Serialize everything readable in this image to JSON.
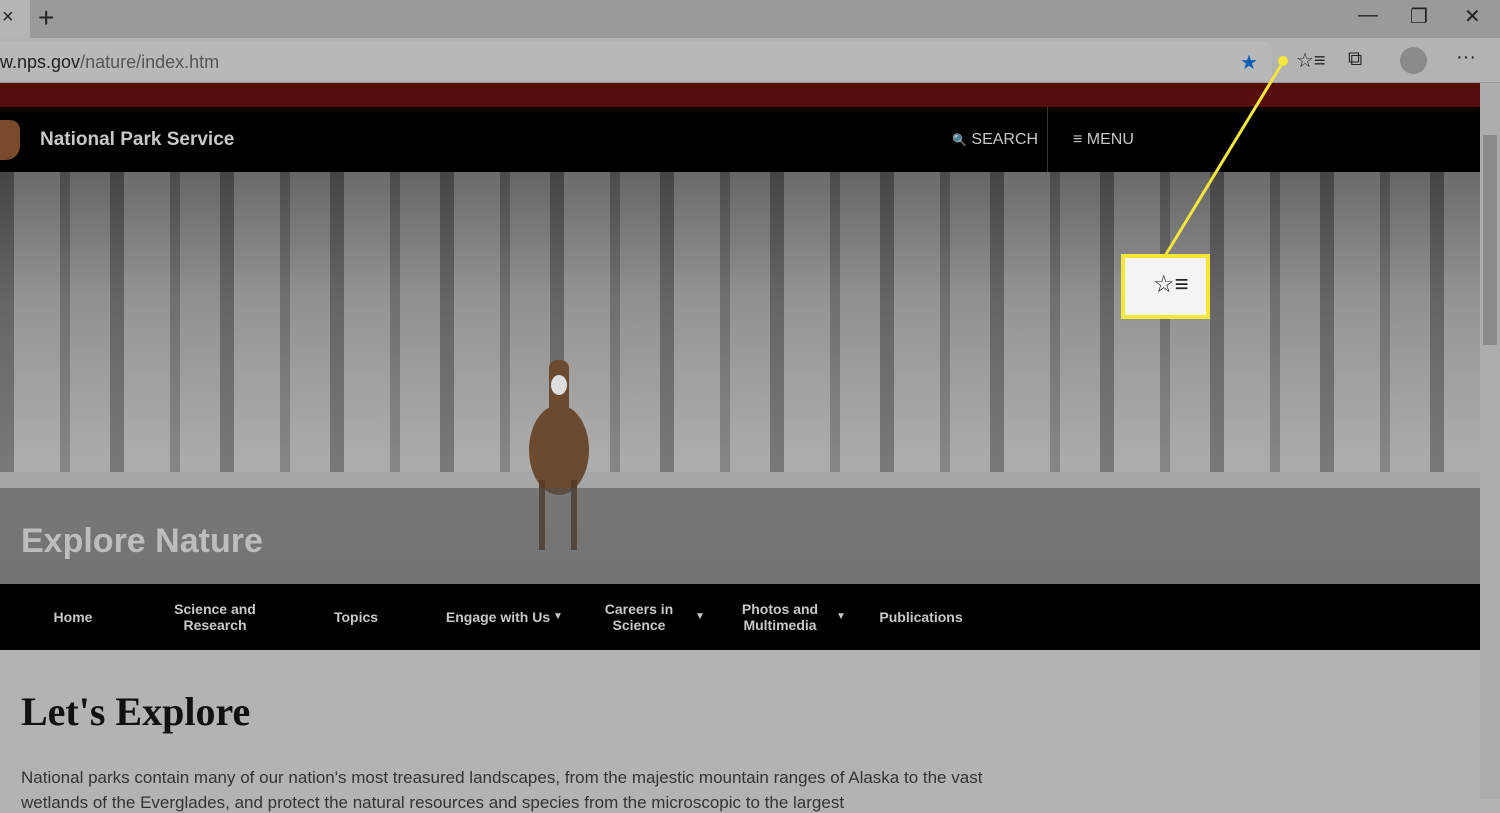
{
  "browser": {
    "close_tab": "×",
    "new_tab": "+",
    "minimize": "—",
    "restore": "❐",
    "close": "✕",
    "url_domain": "w.nps.gov",
    "url_path": "/nature/index.htm",
    "icons": {
      "favorite": "★",
      "favorites": "☆≡",
      "collections": "⧉",
      "more": "···"
    },
    "favorite_color": "#0a5fb4"
  },
  "site": {
    "title": "National Park Service",
    "search": "SEARCH",
    "menu": "MENU",
    "search_icon": "🔍",
    "menu_icon": "≡"
  },
  "hero": {
    "title": "Explore Nature"
  },
  "nav": [
    {
      "label": "Home"
    },
    {
      "label": "Science and Research"
    },
    {
      "label": "Topics"
    },
    {
      "label": "Engage with Us"
    },
    {
      "label": "Careers in Science"
    },
    {
      "label": "Photos and Multimedia"
    },
    {
      "label": "Publications"
    }
  ],
  "nav_caret": "▼",
  "content": {
    "heading": "Let's Explore",
    "paragraph": "National parks contain many of our nation's most treasured landscapes, from the majestic mountain ranges of Alaska to the vast",
    "paragraph_line2": "wetlands of the Everglades, and protect the natural resources and species from the microscopic to the largest"
  },
  "callout": {
    "icon": "☆≡",
    "highlight_color": "#f3e63d"
  }
}
